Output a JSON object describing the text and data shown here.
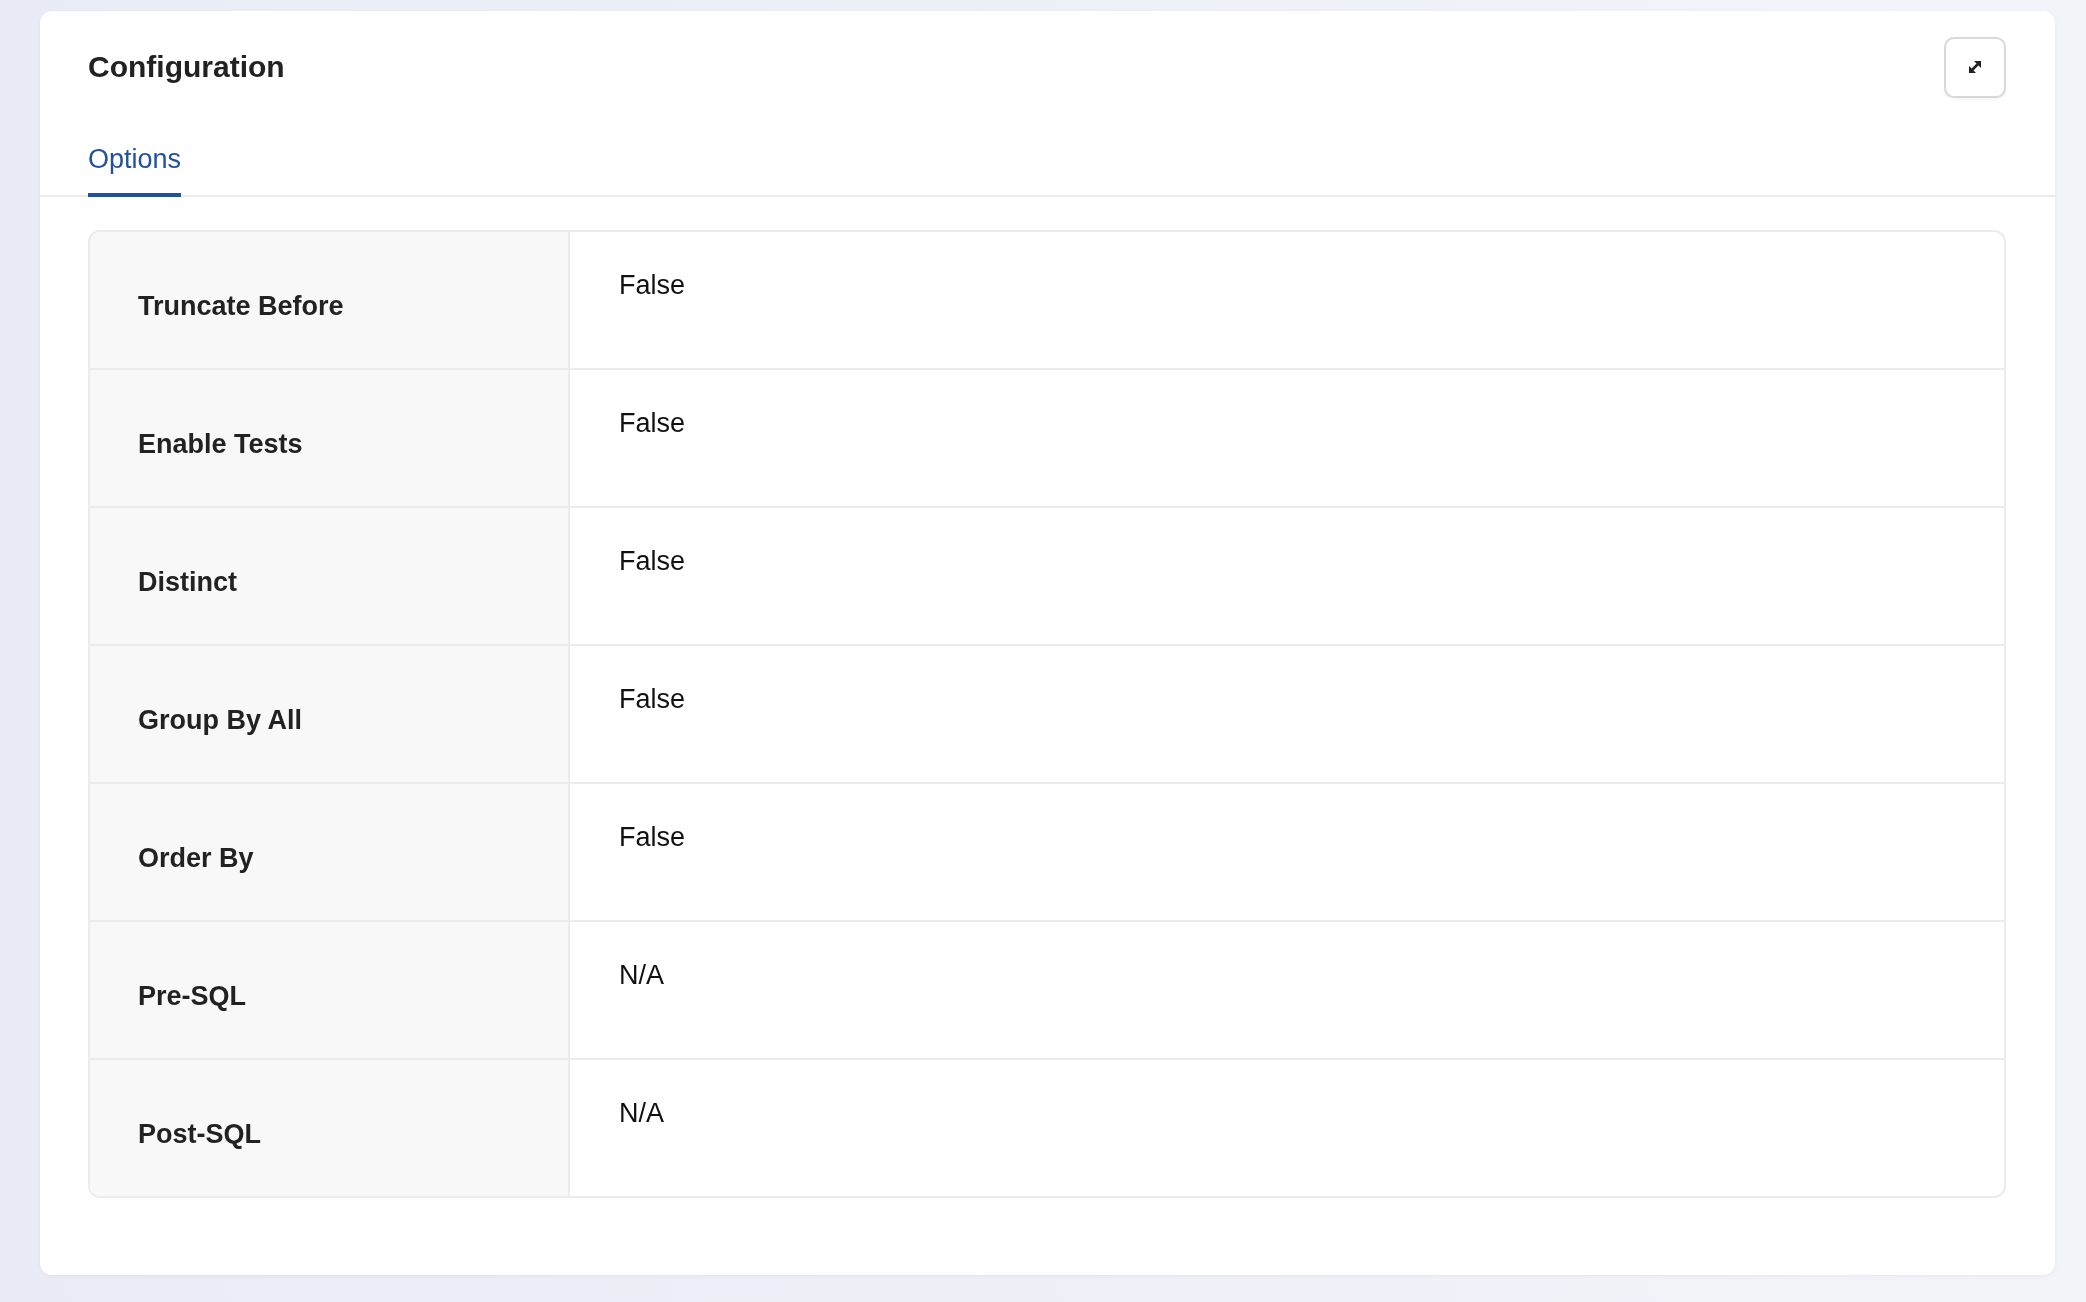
{
  "card": {
    "title": "Configuration"
  },
  "tabs": [
    {
      "label": "Options",
      "selected": true
    }
  ],
  "options": [
    {
      "label": "Truncate Before",
      "value": "False"
    },
    {
      "label": "Enable Tests",
      "value": "False"
    },
    {
      "label": "Distinct",
      "value": "False"
    },
    {
      "label": "Group By All",
      "value": "False"
    },
    {
      "label": "Order By",
      "value": "False"
    },
    {
      "label": "Pre-SQL",
      "value": "N/A"
    },
    {
      "label": "Post-SQL",
      "value": "N/A"
    }
  ]
}
